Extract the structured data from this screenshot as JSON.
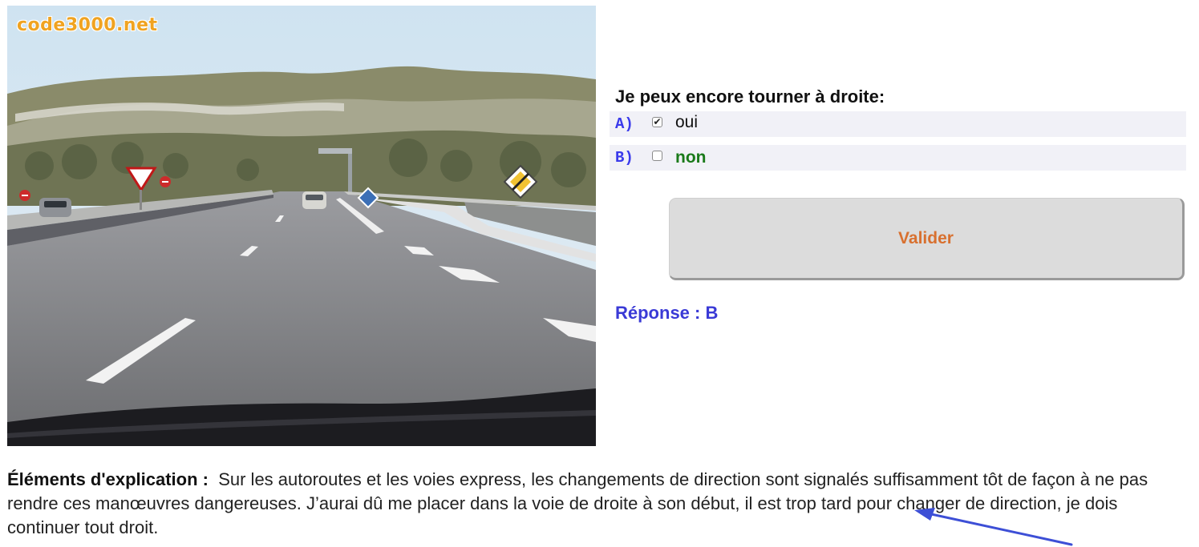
{
  "photo": {
    "watermark": "code3000.net",
    "colors": {
      "sky": "#d3e6f2",
      "road": "#7d7d80",
      "dashboard": "#1c1c20"
    }
  },
  "quiz": {
    "question": "Je peux encore tourner à droite:",
    "options": [
      {
        "letter": "A)",
        "text": "oui",
        "checked": true,
        "color": "#111111"
      },
      {
        "letter": "B)",
        "text": "non",
        "checked": false,
        "color": "#1a7a1a"
      }
    ],
    "validate_label": "Valider",
    "answer": "Réponse : B"
  },
  "explanation": {
    "label": "Éléments d'explication :",
    "text": "Sur les autoroutes et les voies express, les changements de direction sont signalés suffisamment tôt de façon à ne pas rendre ces manœuvres dangereuses. J’aurai dû me placer dans la voie de droite à son début, il est trop tard pour changer de direction, je dois continuer tout droit."
  },
  "annotation": {
    "arrow_color": "#3d4fd6",
    "arrow_icon": "arrow-annotation-icon"
  },
  "colors": {
    "accent_blue": "#3a3aeb",
    "validate_text": "#d8702f",
    "correct_green": "#1a7a1a"
  }
}
